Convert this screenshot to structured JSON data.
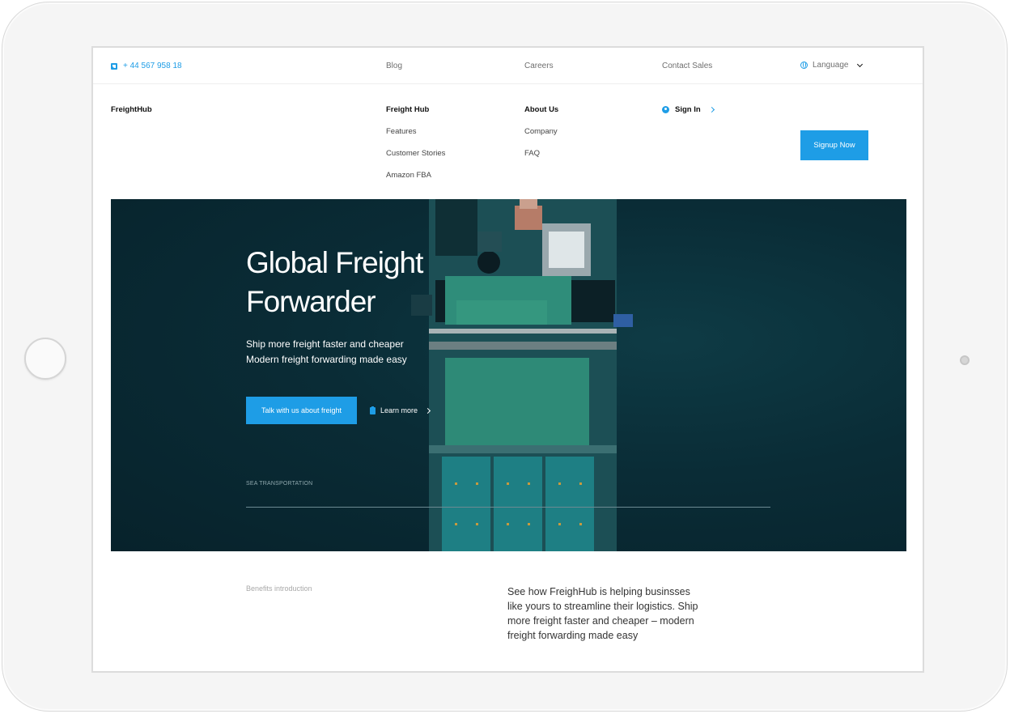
{
  "topbar": {
    "phone": "+ 44 567 958 18",
    "links": [
      "Blog",
      "Careers",
      "Contact Sales"
    ],
    "language_label": "Language"
  },
  "nav": {
    "brand": "FreightHub",
    "columns": [
      {
        "heading": "Freight Hub",
        "items": [
          "Features",
          "Customer Stories",
          "Amazon FBA"
        ]
      },
      {
        "heading": "About Us",
        "items": [
          "Company",
          "FAQ"
        ]
      }
    ],
    "signin_label": "Sign In",
    "signup_label": "Signup Now"
  },
  "hero": {
    "title": "Global Freight Forwarder",
    "subtitle_line1": "Ship more freight faster and cheaper",
    "subtitle_line2": "Modern freight forwarding made easy",
    "cta_label": "Talk with us about freight",
    "learn_more_label": "Learn more",
    "section_label": "SEA TRANSPORTATION"
  },
  "benefits": {
    "label": "Benefits introduction",
    "text": "See how FreighHub is helping businsses like yours to streamline their logistics. Ship more freight faster and cheaper – modern freight forwarding made easy"
  },
  "colors": {
    "accent": "#1e9de6",
    "hero_bg": "#0a2c36",
    "ship_deck": "#2a8a78"
  },
  "icons": [
    "phone-icon",
    "globe-icon",
    "chevron-down-icon",
    "user-icon",
    "chevron-right-icon",
    "clipboard-icon"
  ]
}
